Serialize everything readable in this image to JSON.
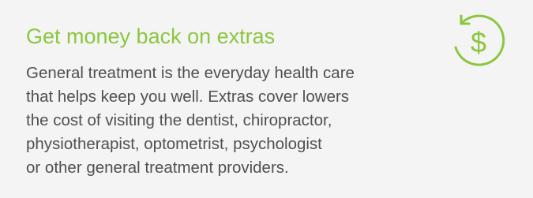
{
  "card": {
    "title": "Get money back on extras",
    "body_lines": [
      "General treatment is the everyday health care",
      "that helps keep you well. Extras cover lowers",
      "the cost of visiting the dentist, chiropractor,",
      "physiotherapist, optometrist, psychologist",
      "or other general treatment providers."
    ],
    "icon": "money-back-icon",
    "icon_glyph": "$"
  },
  "colors": {
    "accent": "#8cc63f",
    "text": "#505050",
    "background": "#f4f4f4"
  }
}
